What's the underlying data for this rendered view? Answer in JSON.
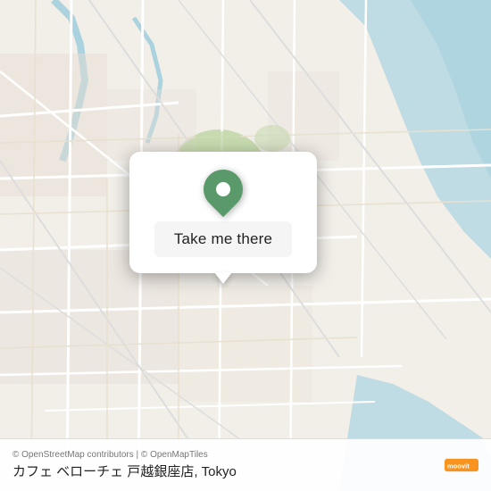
{
  "map": {
    "attribution": "© OpenStreetMap contributors | © OpenMapTiles",
    "location_label": "カフェ ベローチェ 戸越銀座店, Tokyo",
    "take_me_there": "Take me there"
  },
  "moovit": {
    "logo_text": "moovit"
  }
}
